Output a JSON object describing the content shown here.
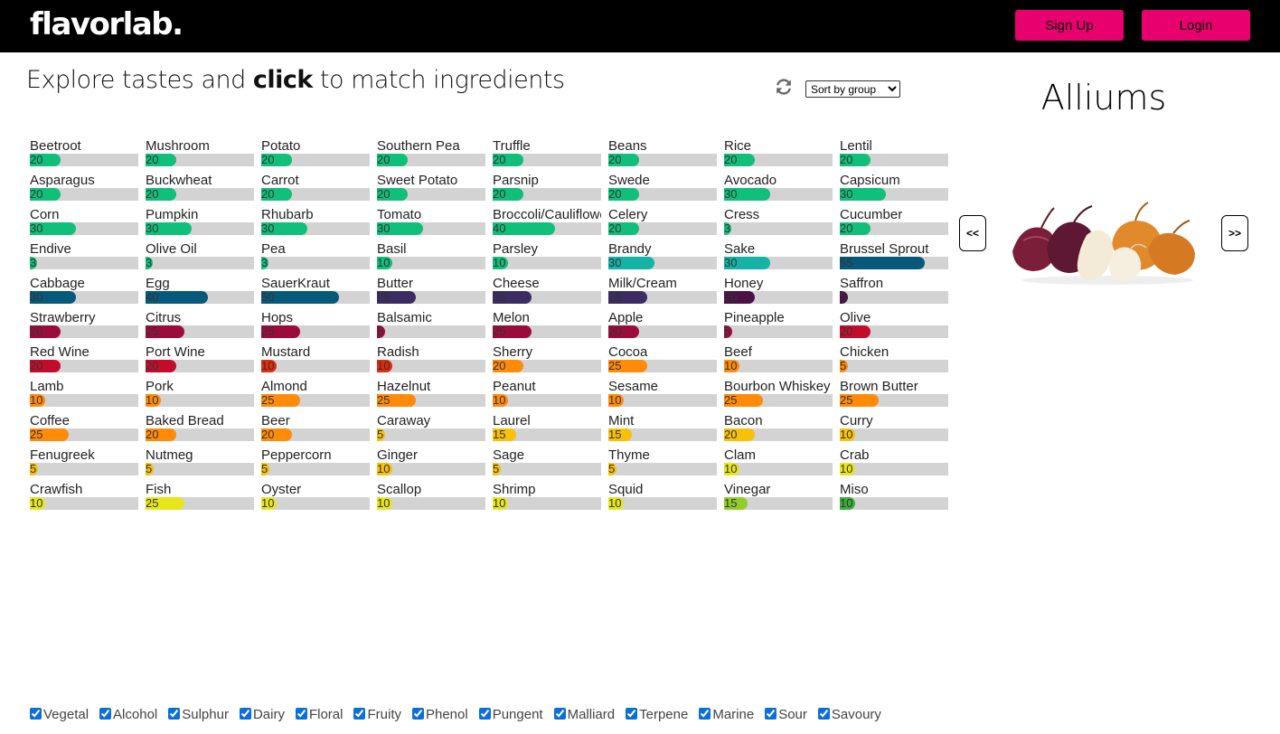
{
  "header": {
    "logo": "flavorlab.",
    "signup_label": "Sign Up",
    "login_label": "Login"
  },
  "explore": {
    "title_part1": "Explore tastes and ",
    "title_bold": "click",
    "title_part2": " to match ingredients",
    "sort_selected": "Sort by group",
    "refresh_icon": "refresh-icon"
  },
  "group": {
    "title": "Alliums",
    "prev_label": "<<",
    "next_label": ">>",
    "image": "onions"
  },
  "colors": {
    "vegetal": "#0fbf7a",
    "alcohol": "#14b3a6",
    "sulphur": "#07597a",
    "dairy": "#3b2c64",
    "floral": "#4a1149",
    "fruity": "#9b0c3d",
    "phenol": "#c30c2c",
    "pungent": "#e02b10",
    "malliard": "#ff8b08",
    "terpene": "#f7c009",
    "marine": "#e6e61a",
    "sour": "#8fce2a",
    "savoury": "#3cae3c"
  },
  "ingredients": [
    [
      {
        "name": "Beetroot",
        "value": 20,
        "group": "vegetal"
      },
      {
        "name": "Asparagus",
        "value": 20,
        "group": "vegetal"
      },
      {
        "name": "Corn",
        "value": 30,
        "group": "vegetal"
      },
      {
        "name": "Endive",
        "value": 3,
        "group": "vegetal"
      },
      {
        "name": "Cabbage",
        "value": 30,
        "group": "sulphur"
      },
      {
        "name": "Strawberry",
        "value": 20,
        "group": "fruity"
      },
      {
        "name": "Red Wine",
        "value": 20,
        "group": "phenol"
      },
      {
        "name": "Lamb",
        "value": 10,
        "group": "malliard"
      },
      {
        "name": "Coffee",
        "value": 25,
        "group": "malliard"
      },
      {
        "name": "Fenugreek",
        "value": 5,
        "group": "terpene"
      },
      {
        "name": "Crawfish",
        "value": 10,
        "group": "marine"
      }
    ],
    [
      {
        "name": "Mushroom",
        "value": 20,
        "group": "vegetal"
      },
      {
        "name": "Buckwheat",
        "value": 20,
        "group": "vegetal"
      },
      {
        "name": "Pumpkin",
        "value": 30,
        "group": "vegetal"
      },
      {
        "name": "Olive Oil",
        "value": 3,
        "group": "vegetal"
      },
      {
        "name": "Egg",
        "value": 40,
        "group": "sulphur"
      },
      {
        "name": "Citrus",
        "value": 25,
        "group": "fruity"
      },
      {
        "name": "Port Wine",
        "value": 20,
        "group": "phenol"
      },
      {
        "name": "Pork",
        "value": 10,
        "group": "malliard"
      },
      {
        "name": "Baked Bread",
        "value": 20,
        "group": "malliard"
      },
      {
        "name": "Nutmeg",
        "value": 5,
        "group": "terpene"
      },
      {
        "name": "Fish",
        "value": 25,
        "group": "marine"
      }
    ],
    [
      {
        "name": "Potato",
        "value": 20,
        "group": "vegetal"
      },
      {
        "name": "Carrot",
        "value": 20,
        "group": "vegetal"
      },
      {
        "name": "Rhubarb",
        "value": 30,
        "group": "vegetal"
      },
      {
        "name": "Pea",
        "value": 3,
        "group": "vegetal"
      },
      {
        "name": "SauerKraut",
        "value": 50,
        "group": "sulphur"
      },
      {
        "name": "Hops",
        "value": 25,
        "group": "fruity"
      },
      {
        "name": "Mustard",
        "value": 10,
        "group": "pungent"
      },
      {
        "name": "Almond",
        "value": 25,
        "group": "malliard"
      },
      {
        "name": "Beer",
        "value": 20,
        "group": "malliard"
      },
      {
        "name": "Peppercorn",
        "value": 5,
        "group": "terpene"
      },
      {
        "name": "Oyster",
        "value": 10,
        "group": "marine"
      }
    ],
    [
      {
        "name": "Southern Pea",
        "value": 20,
        "group": "vegetal"
      },
      {
        "name": "Sweet Potato",
        "value": 20,
        "group": "vegetal"
      },
      {
        "name": "Tomato",
        "value": 30,
        "group": "vegetal"
      },
      {
        "name": "Basil",
        "value": 10,
        "group": "vegetal"
      },
      {
        "name": "Butter",
        "value": 25,
        "group": "dairy"
      },
      {
        "name": "Balsamic",
        "value": 5,
        "group": "fruity"
      },
      {
        "name": "Radish",
        "value": 10,
        "group": "pungent"
      },
      {
        "name": "Hazelnut",
        "value": 25,
        "group": "malliard"
      },
      {
        "name": "Caraway",
        "value": 5,
        "group": "terpene"
      },
      {
        "name": "Ginger",
        "value": 10,
        "group": "terpene"
      },
      {
        "name": "Scallop",
        "value": 10,
        "group": "marine"
      }
    ],
    [
      {
        "name": "Truffle",
        "value": 20,
        "group": "vegetal"
      },
      {
        "name": "Parsnip",
        "value": 20,
        "group": "vegetal"
      },
      {
        "name": "Broccoli/Cauliflower",
        "value": 40,
        "group": "vegetal"
      },
      {
        "name": "Parsley",
        "value": 10,
        "group": "vegetal"
      },
      {
        "name": "Cheese",
        "value": 25,
        "group": "dairy"
      },
      {
        "name": "Melon",
        "value": 25,
        "group": "fruity"
      },
      {
        "name": "Sherry",
        "value": 20,
        "group": "malliard"
      },
      {
        "name": "Peanut",
        "value": 10,
        "group": "malliard"
      },
      {
        "name": "Laurel",
        "value": 15,
        "group": "terpene"
      },
      {
        "name": "Sage",
        "value": 5,
        "group": "terpene"
      },
      {
        "name": "Shrimp",
        "value": 10,
        "group": "marine"
      }
    ],
    [
      {
        "name": "Beans",
        "value": 20,
        "group": "vegetal"
      },
      {
        "name": "Swede",
        "value": 20,
        "group": "vegetal"
      },
      {
        "name": "Celery",
        "value": 20,
        "group": "vegetal"
      },
      {
        "name": "Brandy",
        "value": 30,
        "group": "alcohol"
      },
      {
        "name": "Milk/Cream",
        "value": 25,
        "group": "dairy"
      },
      {
        "name": "Apple",
        "value": 20,
        "group": "fruity"
      },
      {
        "name": "Cocoa",
        "value": 25,
        "group": "malliard"
      },
      {
        "name": "Sesame",
        "value": 10,
        "group": "malliard"
      },
      {
        "name": "Mint",
        "value": 15,
        "group": "terpene"
      },
      {
        "name": "Thyme",
        "value": 5,
        "group": "terpene"
      },
      {
        "name": "Squid",
        "value": 10,
        "group": "marine"
      }
    ],
    [
      {
        "name": "Rice",
        "value": 20,
        "group": "vegetal"
      },
      {
        "name": "Avocado",
        "value": 30,
        "group": "vegetal"
      },
      {
        "name": "Cress",
        "value": 3,
        "group": "vegetal"
      },
      {
        "name": "Sake",
        "value": 30,
        "group": "alcohol"
      },
      {
        "name": "Honey",
        "value": 20,
        "group": "floral"
      },
      {
        "name": "Pineapple",
        "value": 5,
        "group": "fruity"
      },
      {
        "name": "Beef",
        "value": 10,
        "group": "malliard"
      },
      {
        "name": "Bourbon Whiskey",
        "value": 25,
        "group": "malliard"
      },
      {
        "name": "Bacon",
        "value": 20,
        "group": "terpene"
      },
      {
        "name": "Clam",
        "value": 10,
        "group": "marine"
      },
      {
        "name": "Vinegar",
        "value": 15,
        "group": "sour"
      }
    ],
    [
      {
        "name": "Lentil",
        "value": 20,
        "group": "vegetal"
      },
      {
        "name": "Capsicum",
        "value": 30,
        "group": "vegetal"
      },
      {
        "name": "Cucumber",
        "value": 20,
        "group": "vegetal"
      },
      {
        "name": "Brussel Sprout",
        "value": 55,
        "group": "sulphur"
      },
      {
        "name": "Saffron",
        "value": 5,
        "group": "floral"
      },
      {
        "name": "Olive",
        "value": 20,
        "group": "phenol"
      },
      {
        "name": "Chicken",
        "value": 5,
        "group": "malliard"
      },
      {
        "name": "Brown Butter",
        "value": 25,
        "group": "malliard"
      },
      {
        "name": "Curry",
        "value": 10,
        "group": "terpene"
      },
      {
        "name": "Crab",
        "value": 10,
        "group": "marine"
      },
      {
        "name": "Miso",
        "value": 10,
        "group": "savoury"
      }
    ]
  ],
  "filters": [
    {
      "label": "Vegetal",
      "checked": true
    },
    {
      "label": "Alcohol",
      "checked": true
    },
    {
      "label": "Sulphur",
      "checked": true
    },
    {
      "label": "Dairy",
      "checked": true
    },
    {
      "label": "Floral",
      "checked": true
    },
    {
      "label": "Fruity",
      "checked": true
    },
    {
      "label": "Phenol",
      "checked": true
    },
    {
      "label": "Pungent",
      "checked": true
    },
    {
      "label": "Malliard",
      "checked": true
    },
    {
      "label": "Terpene",
      "checked": true
    },
    {
      "label": "Marine",
      "checked": true
    },
    {
      "label": "Sour",
      "checked": true
    },
    {
      "label": "Savoury",
      "checked": true
    }
  ]
}
